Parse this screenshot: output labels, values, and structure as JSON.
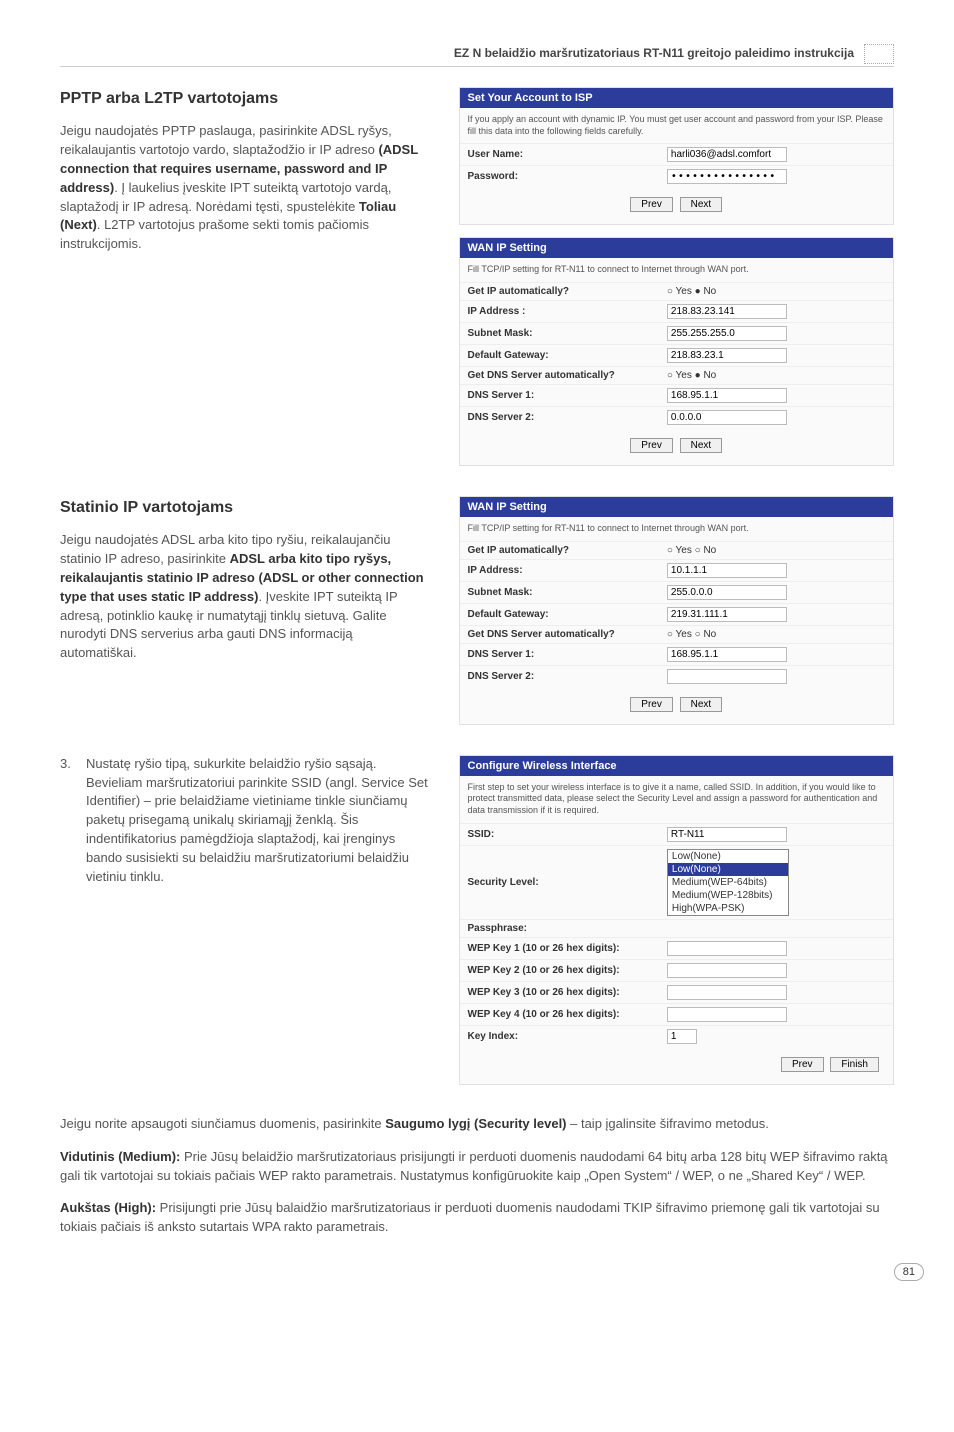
{
  "header": {
    "title": "EZ N belaidžio maršrutizatoriaus RT-N11 greitojo paleidimo instrukcija"
  },
  "section_pptp": {
    "heading": "PPTP arba L2TP vartotojams",
    "body_html": "Jeigu naudojatės PPTP paslauga, pasirinkite ADSL ryšys, reikalaujantis vartotojo vardo, slaptažodžio ir IP adreso <b>(ADSL connection that requires username, password and IP address)</b>. Į laukelius įveskite IPT suteiktą vartotojo vardą, slaptažodį ir IP adresą. Norėdami tęsti, spustelėkite <b>Toliau (Next)</b>. L2TP vartotojus prašome sekti tomis pačiomis instrukcijomis."
  },
  "panel_account": {
    "title": "Set Your Account to ISP",
    "desc": "If you apply an account with dynamic IP. You must get user account and password from your ISP. Please fill this data into the following fields carefully.",
    "rows": {
      "user_label": "User Name:",
      "user_value": "harli036@adsl.comfort",
      "pass_label": "Password:",
      "pass_value": "•••••••••••••••"
    },
    "prev": "Prev",
    "next": "Next"
  },
  "panel_wan1": {
    "title": "WAN IP Setting",
    "desc": "Fill TCP/IP setting for RT-N11 to connect to Internet through WAN port.",
    "rows": {
      "getip_label": "Get IP automatically?",
      "getip_value": "○ Yes  ● No",
      "ip_label": "IP Address :",
      "ip_value": "218.83.23.141",
      "mask_label": "Subnet Mask:",
      "mask_value": "255.255.255.0",
      "gw_label": "Default Gateway:",
      "gw_value": "218.83.23.1",
      "getdns_label": "Get DNS Server automatically?",
      "getdns_value": "○ Yes  ● No",
      "dns1_label": "DNS Server 1:",
      "dns1_value": "168.95.1.1",
      "dns2_label": "DNS Server 2:",
      "dns2_value": "0.0.0.0"
    },
    "prev": "Prev",
    "next": "Next"
  },
  "section_static": {
    "heading": "Statinio IP vartotojams",
    "body_html": "Jeigu naudojatės ADSL arba kito tipo ryšiu, reikalaujančiu statinio IP adreso, pasirinkite <b>ADSL arba kito tipo ryšys, reikalaujantis statinio IP adreso (ADSL or other connection type that uses static IP address)</b>. Įveskite IPT suteiktą IP adresą, potinklio kaukę ir numatytąjį tinklų sietuvą. Galite nurodyti DNS serverius arba gauti DNS informaciją automatiškai."
  },
  "panel_wan2": {
    "title": "WAN IP Setting",
    "desc": "Fill TCP/IP setting for RT-N11 to connect to Internet through WAN port.",
    "rows": {
      "getip_label": "Get IP automatically?",
      "getip_value": "○ Yes ○ No",
      "ip_label": "IP Address:",
      "ip_value": "10.1.1.1",
      "mask_label": "Subnet Mask:",
      "mask_value": "255.0.0.0",
      "gw_label": "Default Gateway:",
      "gw_value": "219.31.111.1",
      "getdns_label": "Get DNS Server automatically?",
      "getdns_value": "○ Yes ○ No",
      "dns1_label": "DNS Server 1:",
      "dns1_value": "168.95.1.1",
      "dns2_label": "DNS Server 2:",
      "dns2_value": ""
    },
    "prev": "Prev",
    "next": "Next"
  },
  "list_item": {
    "number": "3.",
    "body": "Nustatę ryšio tipą, sukurkite belaidžio ryšio sąsają.  Bevieliam maršrutizatoriui parinkite SSID (angl. Service Set Identifier) – prie belaidžiame vietiniame tinkle siunčiamų paketų prisegamą unikalų skiriamąjį ženklą. Šis indentifikatorius pamėgdžioja slaptažodį, kai įrenginys bando susisiekti su belaidžiu maršrutizatoriumi belaidžiu vietiniu tinklu."
  },
  "panel_wireless": {
    "title": "Configure Wireless Interface",
    "desc": "First step to set your wireless interface is to give it a name, called SSID. In addition, if you would like to protect transmitted data, please select the Security Level and assign a password for authentication and data transmission if it is required.",
    "rows": {
      "ssid_label": "SSID:",
      "ssid_value": "RT-N11",
      "sec_label": "Security Level:",
      "sec_selected": "Low(None)",
      "sec_options": [
        "Low(None)",
        "Medium(WEP-64bits)",
        "Medium(WEP-128bits)",
        "High(WPA-PSK)"
      ],
      "pass_label": "Passphrase:",
      "wep1_label": "WEP Key 1 (10 or 26 hex digits):",
      "wep2_label": "WEP Key 2 (10 or 26 hex digits):",
      "wep3_label": "WEP Key 3 (10 or 26 hex digits):",
      "wep4_label": "WEP Key 4 (10 or 26 hex digits):",
      "keyidx_label": "Key Index:",
      "keyidx_value": "1"
    },
    "prev": "Prev",
    "finish": "Finish"
  },
  "lower": {
    "p1_html": "Jeigu norite apsaugoti siunčiamus duomenis, pasirinkite <b>Saugumo lygį (Security level)</b> – taip įgalinsite šifravimo metodus.",
    "p2_html": "<b>Vidutinis (Medium):</b> Prie Jūsų belaidžio maršrutizatoriaus prisijungti ir perduoti duomenis naudodami 64 bitų arba 128 bitų WEP šifravimo raktą gali tik vartotojai su tokiais pačiais WEP rakto parametrais. Nustatymus konfigūruokite kaip „Open System“ / WEP, o ne „Shared Key“ / WEP.",
    "p3_html": "<b>Aukštas (High):</b> Prisijungti prie Jūsų balaidžio maršrutizatoriaus ir perduoti duomenis naudodami TKIP šifravimo priemonę gali tik vartotojai su tokiais pačiais iš anksto sutartais WPA rakto parametrais."
  },
  "page_number": "81"
}
